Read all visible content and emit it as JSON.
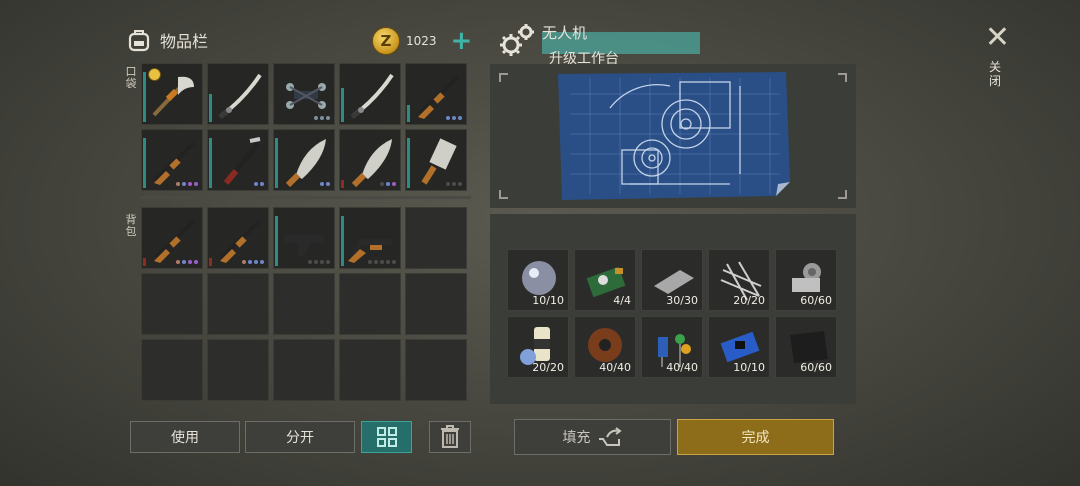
{
  "inventory": {
    "title": "物品栏",
    "coins": "1023",
    "pocket_label": "口袋",
    "backpack_label": "背包"
  },
  "pocket_slots": [
    {
      "item": "glaive",
      "dots": [],
      "bar": 0.9,
      "badge": true
    },
    {
      "item": "katana",
      "dots": [],
      "bar": 0.5
    },
    {
      "item": "drone",
      "dots": [
        "#7d8f9a",
        "#7d8f9a",
        "#7d8f9a"
      ],
      "bar": 0
    },
    {
      "item": "katana",
      "dots": [],
      "bar": 0.6
    },
    {
      "item": "rifle",
      "dots": [
        "#6e86c9",
        "#6e86c9",
        "#6e86c9"
      ],
      "bar": 0.3
    },
    {
      "item": "rifle",
      "dots": [
        "#b07d68",
        "#6e86c9",
        "#9c5fc9",
        "#9c5fc9"
      ],
      "bar": 0.9
    },
    {
      "item": "crowbar",
      "dots": [
        "#6e86c9",
        "#6e86c9"
      ],
      "bar": 0.9
    },
    {
      "item": "machete",
      "dots": [
        "#6e86c9",
        "#6e86c9"
      ],
      "bar": 0.9
    },
    {
      "item": "machete",
      "dots": [
        "#4c4c4c",
        "#6e86c9",
        "#9c5fc9"
      ],
      "bar": 0.15,
      "red": true
    },
    {
      "item": "cleaver",
      "dots": [
        "#4c4c4c",
        "#4c4c4c",
        "#4c4c4c"
      ],
      "bar": 0.9
    }
  ],
  "backpack_slots": [
    {
      "item": "rifle",
      "dots": [
        "#b07d68",
        "#6e86c9",
        "#9c5fc9",
        "#9c5fc9"
      ],
      "bar": 0.15,
      "red": true
    },
    {
      "item": "rifle",
      "dots": [
        "#b07d68",
        "#6e86c9",
        "#6e86c9",
        "#6e86c9"
      ],
      "bar": 0.15,
      "red": true
    },
    {
      "item": "smg",
      "dots": [
        "#4c4c4c",
        "#4c4c4c",
        "#4c4c4c",
        "#4c4c4c"
      ],
      "bar": 0.9
    },
    {
      "item": "shotgun",
      "dots": [
        "#4c4c4c",
        "#4c4c4c",
        "#4c4c4c",
        "#4c4c4c",
        "#4c4c4c"
      ],
      "bar": 0.9
    }
  ],
  "buttons": {
    "use": "使用",
    "split": "分开",
    "fill": "填充",
    "done": "完成"
  },
  "craft": {
    "name": "无人机",
    "subtitle": "升级工作台",
    "close": "关闭"
  },
  "materials": [
    {
      "name": "lens",
      "qty": "10/10"
    },
    {
      "name": "circuit-board",
      "qty": "4/4"
    },
    {
      "name": "steel-plate",
      "qty": "30/30"
    },
    {
      "name": "wire-mesh",
      "qty": "20/20"
    },
    {
      "name": "gear-mechanism",
      "qty": "60/60"
    },
    {
      "name": "glue-bottle",
      "qty": "20/20"
    },
    {
      "name": "copper-coil",
      "qty": "40/40"
    },
    {
      "name": "capacitors",
      "qty": "40/40"
    },
    {
      "name": "microchip",
      "qty": "10/10"
    },
    {
      "name": "leather",
      "qty": "60/60"
    }
  ],
  "colors": {
    "accent": "#3fb3a8",
    "gold": "#8d6d1a"
  }
}
